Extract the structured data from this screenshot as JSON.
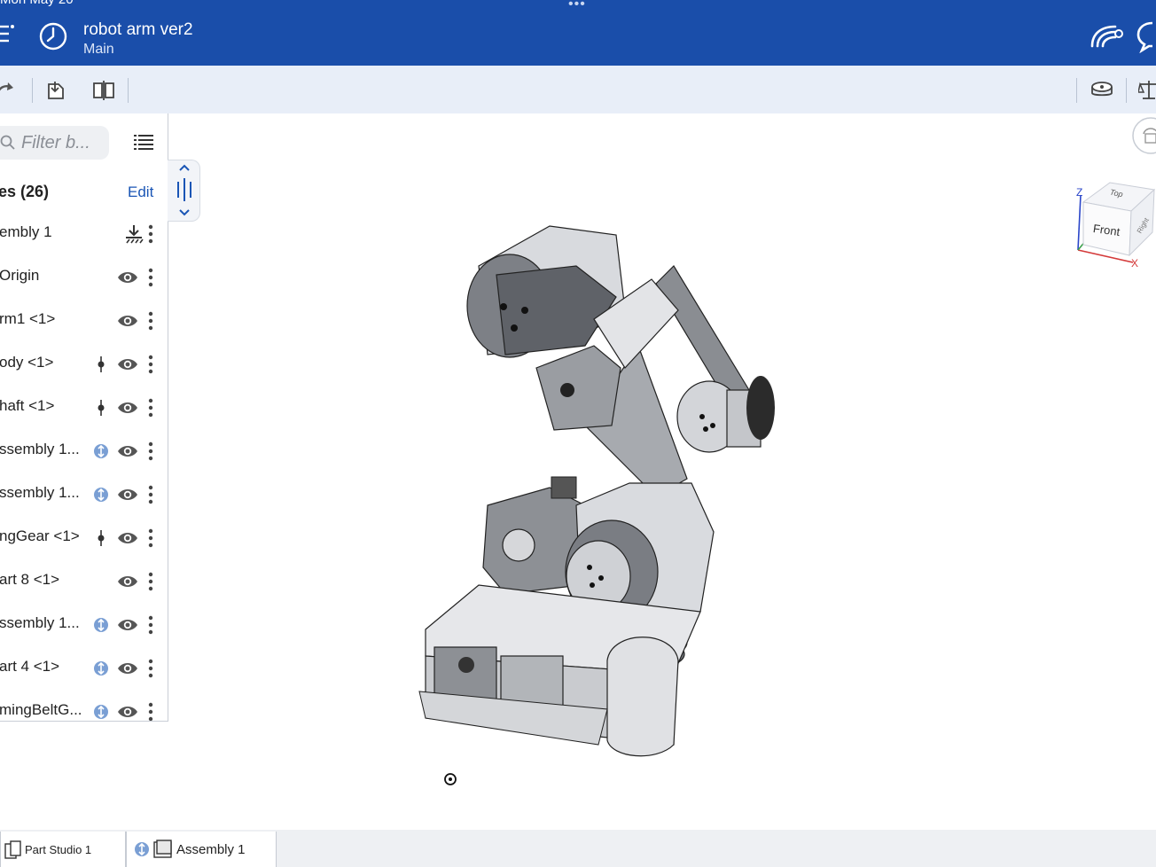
{
  "status_bar": {
    "time": "Mon May 20",
    "dots": "•••"
  },
  "header": {
    "title": "robot arm ver2",
    "branch": "Main",
    "icons": [
      "menu-icon",
      "history-icon",
      "collaboration-icon",
      "comments-icon"
    ]
  },
  "toolbar": {
    "icons": [
      "redo-icon",
      "insert-icon",
      "mate-connector-icon",
      "measure-icon",
      "mass-properties-icon"
    ]
  },
  "panel": {
    "filter_placeholder": "Filter b...",
    "instances_header": "es (26)",
    "edit_label": "Edit",
    "items": [
      {
        "label": "embly 1",
        "status": "fixed"
      },
      {
        "label": "Origin",
        "status": "visible"
      },
      {
        "label": "rm1 <1>",
        "status": "visible"
      },
      {
        "label": "ody <1>",
        "status": "mated"
      },
      {
        "label": "haft <1>",
        "status": "mated"
      },
      {
        "label": "ssembly 1...",
        "status": "linked"
      },
      {
        "label": "ssembly 1...",
        "status": "linked"
      },
      {
        "label": "ngGear <1>",
        "status": "mated"
      },
      {
        "label": "art 8 <1>",
        "status": "visible"
      },
      {
        "label": "ssembly 1...",
        "status": "linked"
      },
      {
        "label": "art 4 <1>",
        "status": "linked"
      },
      {
        "label": "mingBeltG...",
        "status": "linked"
      }
    ]
  },
  "viewcube": {
    "front": "Front",
    "top": "Top",
    "right": "Right",
    "axis_z": "Z",
    "axis_x": "X"
  },
  "tabs": [
    {
      "label": "Part Studio 1",
      "active": true
    },
    {
      "label": "Assembly 1",
      "active": false
    }
  ],
  "colors": {
    "header_bg": "#1a4eaa",
    "toolbar_bg": "#e8eef8",
    "accent": "#1a55b5",
    "linked_badge": "#7a9fd4"
  }
}
